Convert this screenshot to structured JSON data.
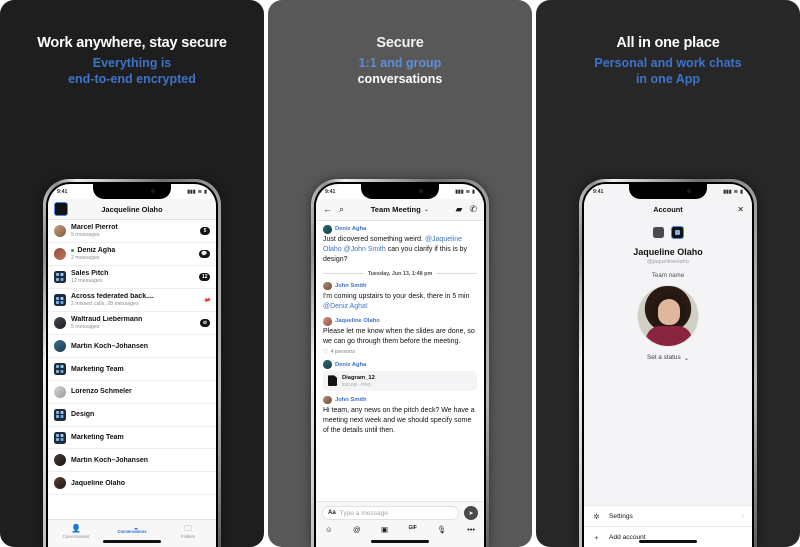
{
  "panels": [
    {
      "id": "panel-secure",
      "headline": "Work anywhere, stay secure",
      "subline_1": "Everything is",
      "subline_2": "end-to-end encrypted"
    },
    {
      "id": "panel-conversations",
      "headline": "Secure",
      "subline_1": "1:1 and group",
      "subline_2": "conversations"
    },
    {
      "id": "panel-one-place",
      "headline": "All in one place",
      "subline_1": "Personal and work chats",
      "subline_2": "in one App"
    }
  ],
  "status_bar": {
    "time": "9:41",
    "signal": "▮▮▮",
    "wifi": "≋",
    "battery": "▮"
  },
  "phone1": {
    "header_title": "Jacqueline Olaho",
    "conversations": [
      {
        "name": "Marcel Pierrot",
        "subtitle": "5 messages",
        "badge": "5",
        "badge_type": "count",
        "avatar": "a1",
        "online": false
      },
      {
        "name": "Deniz Agha",
        "subtitle": "2 messages",
        "badge": "bubble",
        "badge_type": "icon",
        "avatar": "a2",
        "online": true
      },
      {
        "name": "Sales Pitch",
        "subtitle": "12 messages",
        "badge": "12",
        "badge_type": "count",
        "avatar": "group",
        "online": false
      },
      {
        "name": "Across federated back....",
        "subtitle": "2 missed calls, 28 messages",
        "badge": "pin",
        "badge_type": "pin",
        "avatar": "group",
        "online": false
      },
      {
        "name": "Waltraud Liebermann",
        "subtitle": "5 messages",
        "badge": "mute",
        "badge_type": "icon",
        "avatar": "a3",
        "online": false
      },
      {
        "name": "Martin Koch–Johansen",
        "subtitle": "",
        "badge": "",
        "badge_type": "none",
        "avatar": "a4",
        "online": false
      },
      {
        "name": "Marketing Team",
        "subtitle": "",
        "badge": "",
        "badge_type": "none",
        "avatar": "group",
        "online": false
      },
      {
        "name": "Lorenzo Schmeler",
        "subtitle": "",
        "badge": "",
        "badge_type": "none",
        "avatar": "a5",
        "online": false
      },
      {
        "name": "Design",
        "subtitle": "",
        "badge": "",
        "badge_type": "none",
        "avatar": "group",
        "online": false
      },
      {
        "name": "Marketing Team",
        "subtitle": "",
        "badge": "",
        "badge_type": "none",
        "avatar": "group",
        "online": false
      },
      {
        "name": "Martin Koch–Johansen",
        "subtitle": "",
        "badge": "",
        "badge_type": "none",
        "avatar": "a6",
        "online": false
      },
      {
        "name": "Jaqueline Olaho",
        "subtitle": "",
        "badge": "",
        "badge_type": "none",
        "avatar": "a7",
        "online": false
      }
    ],
    "tabs": [
      {
        "label": "Conversations",
        "icon": "person-icon",
        "active": false
      },
      {
        "label": "Conversations",
        "icon": "chat-bubble-icon",
        "active": true
      },
      {
        "label": "Folders",
        "icon": "folder-icon",
        "active": false
      }
    ]
  },
  "phone2": {
    "header": {
      "back_icon": "back-arrow-icon",
      "search_icon": "search-icon",
      "title": "Team Meeting",
      "chevron": "⌄",
      "video_icon": "video-camera-icon",
      "call_icon": "phone-icon"
    },
    "messages": [
      {
        "author": "Deniz Agha",
        "avatar": "deniz",
        "segments": [
          {
            "text": "Just dicovered something weird. ",
            "mention": false
          },
          {
            "text": "@Jaqueline Olaho @John Smith",
            "mention": true
          },
          {
            "text": " can you clarify if this is by design?",
            "mention": false
          }
        ]
      },
      {
        "author": "John Smith",
        "avatar": "john",
        "segments": [
          {
            "text": "I'm coming upstairs to your desk, there in 5 min ",
            "mention": false
          },
          {
            "text": "@Deniz Agha!",
            "mention": true
          }
        ]
      },
      {
        "author": "Jaqueline Olaho",
        "avatar": "jaq",
        "segments": [
          {
            "text": "Please let me know when the slides are done, so we can go through them before the meeting.",
            "mention": false
          }
        ],
        "reaction": "4 persons"
      },
      {
        "author": "Deniz Agha",
        "avatar": "deniz",
        "file": {
          "name": "Diagram_12",
          "meta": "530 KB · PNG"
        }
      },
      {
        "author": "John Smith",
        "avatar": "john",
        "segments": [
          {
            "text": "Hi team, any news on the pitch deck? We have a meeting next week and we should specify some of the details until then.",
            "mention": false
          }
        ]
      }
    ],
    "day_separator": "Tuesday, Jun 13, 1:48 pm",
    "composer": {
      "format_icon": "Aa",
      "placeholder": "Type a message",
      "send_icon": "➤",
      "tools": [
        "emoji-icon",
        "mention-icon",
        "camera-icon",
        "gif-icon",
        "microphone-icon",
        "more-icon"
      ],
      "tool_glyphs": [
        "☺",
        "@",
        "▣",
        "GIF",
        "🎙",
        "•••"
      ]
    }
  },
  "phone3": {
    "header_title": "Account",
    "close_icon": "✕",
    "name": "Jaqueline Olaho",
    "handle": "@jaquelineolaho",
    "team_label": "Team name",
    "set_status": "Set a status",
    "status_chevron": "⌄",
    "rows": [
      {
        "label": "Settings",
        "icon": "gear-icon",
        "glyph": "✲",
        "chevron": "›"
      },
      {
        "label": "Add account",
        "icon": "plus-icon",
        "glyph": "+",
        "chevron": ""
      }
    ]
  },
  "colors": {
    "accent_blue": "#3d74c9",
    "panel1_bg": "#1e1e1e",
    "panel2_bg": "#585858",
    "panel3_bg": "#272727",
    "badge_bg": "#141414",
    "online_green": "#2e9e4f"
  }
}
